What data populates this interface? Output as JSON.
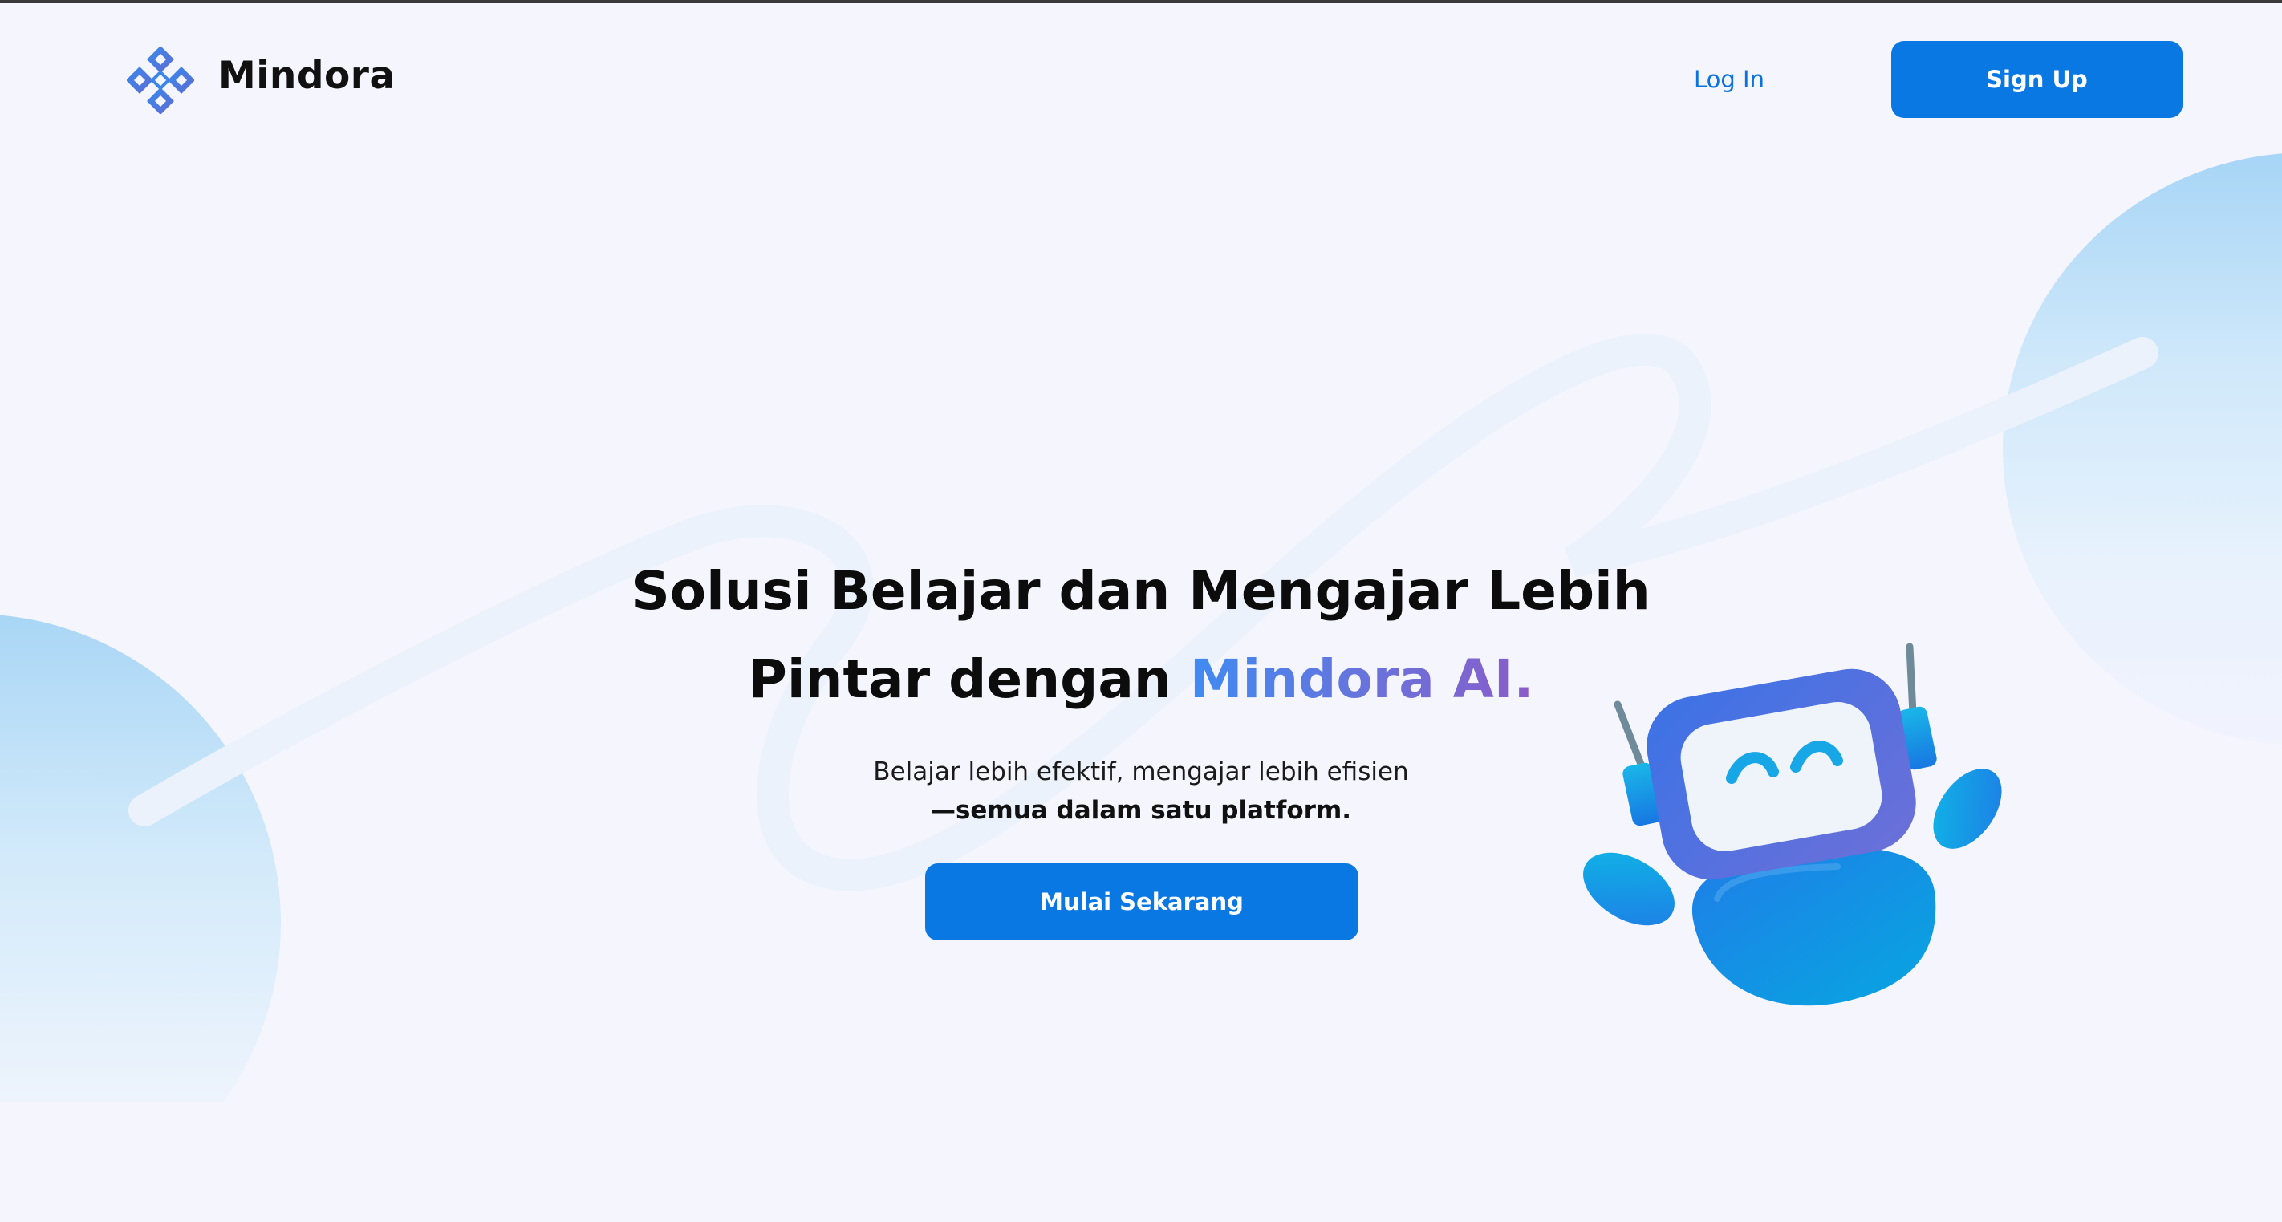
{
  "header": {
    "brand": "Mindora",
    "login_label": "Log In",
    "signup_label": "Sign Up"
  },
  "hero": {
    "title_line1": "Solusi Belajar dan Mengajar Lebih",
    "title_line2_prefix": "Pintar dengan ",
    "title_accent": "Mindora AI.",
    "subtitle_line1": "Belajar lebih efektif, mengajar lebih efisien",
    "subtitle_line2": "—semua dalam satu platform.",
    "cta_label": "Mulai Sekarang"
  },
  "icons": {
    "logo": "mindora-diamond-logo-icon",
    "illustration": "robot-mascot-illustration"
  },
  "colors": {
    "primary": "#0a78e3",
    "accent_start": "#3f8bf2",
    "accent_end": "#8a5cc9",
    "background": "#f5f5fe",
    "text": "#0c0c0c"
  }
}
